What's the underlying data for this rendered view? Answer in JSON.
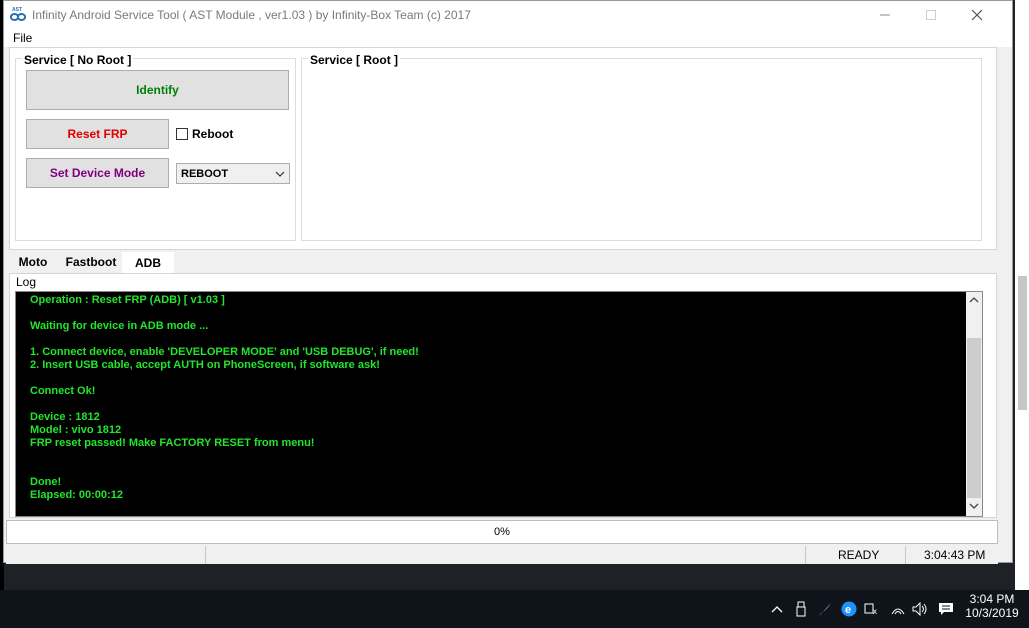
{
  "window": {
    "title": "Infinity Android Service Tool ( AST Module , ver1.03  ) by Infinity-Box Team (c) 2017",
    "icon": "ast-logo-icon",
    "controls": [
      "minimize-icon",
      "maximize-icon",
      "close-icon"
    ]
  },
  "menu": {
    "file": "File"
  },
  "service_no_root": {
    "title": "Service  [ No Root ]",
    "identify_label": "Identify",
    "reset_frp_label": "Reset FRP",
    "reboot_label": "Reboot",
    "reboot_checked": false,
    "set_mode_label": "Set Device Mode",
    "mode_value": "REBOOT"
  },
  "service_root": {
    "title": "Service [ Root ]"
  },
  "tabs": [
    {
      "label": "Moto",
      "active": false
    },
    {
      "label": "Fastboot",
      "active": false
    },
    {
      "label": "ADB",
      "active": true
    }
  ],
  "log": {
    "label": "Log",
    "lines": [
      "Operation : Reset FRP (ADB) [ v1.03 ]",
      "",
      "Waiting for device in ADB mode ...",
      "",
      "1. Connect device, enable 'DEVELOPER MODE' and 'USB DEBUG', if need!",
      "2. Insert USB cable, accept AUTH on PhoneScreen, if software ask!",
      "",
      "Connect Ok!",
      "",
      "Device : 1812",
      "Model  : vivo 1812",
      "FRP reset passed! Make FACTORY RESET from menu!",
      "",
      "",
      "Done!",
      "Elapsed: 00:00:12"
    ]
  },
  "progress": {
    "text": "0%",
    "value": 0
  },
  "statusbar": {
    "state": "READY",
    "time": "3:04:43 PM"
  },
  "taskbar": {
    "clock_time": "3:04 PM",
    "clock_date": "10/3/2019"
  },
  "colors": {
    "identify": "#008000",
    "reset_frp": "#e00000",
    "set_mode": "#800080",
    "log_text": "#22e52c",
    "log_bg": "#000000"
  }
}
